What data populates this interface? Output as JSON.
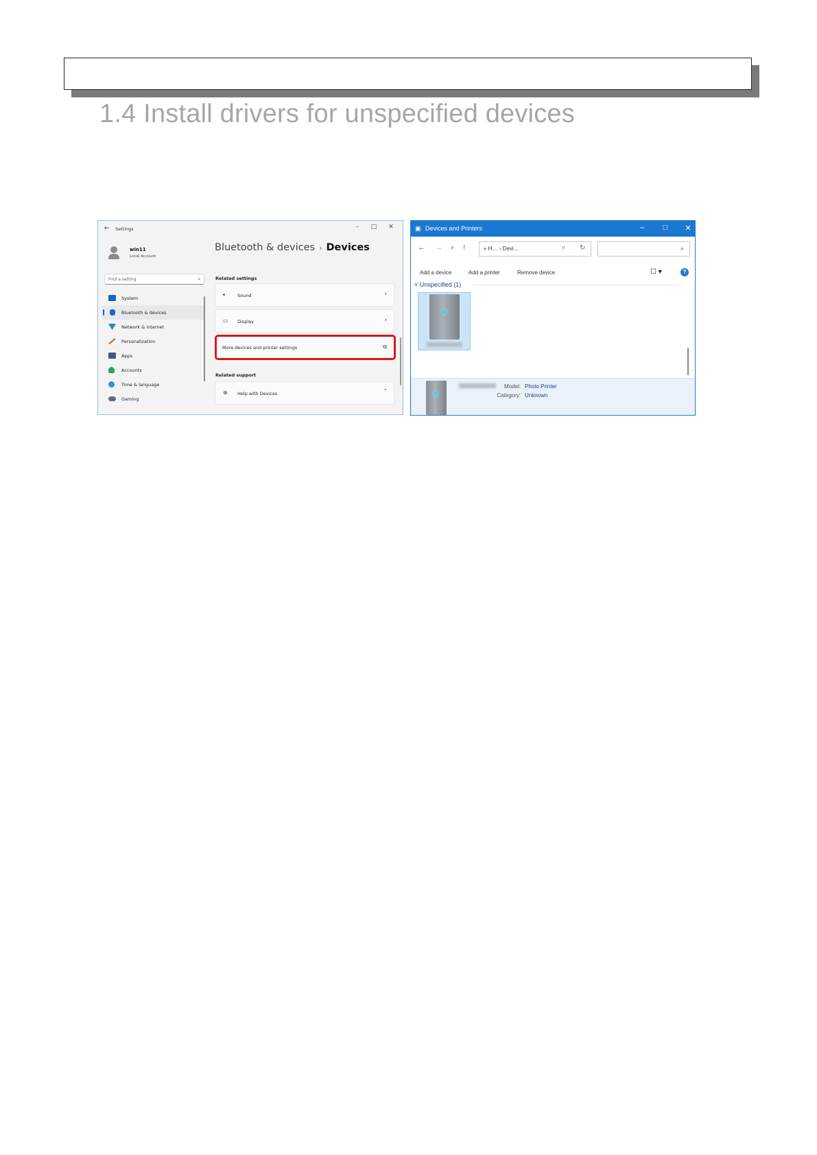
{
  "page": {
    "section_title": "1.4 Install drivers for unspecified devices"
  },
  "settings": {
    "app_title": "Settings",
    "user_name": "win11",
    "account_type": "Local Account",
    "search_placeholder": "Find a setting",
    "nav": [
      {
        "label": "System",
        "color": "#1a66c2"
      },
      {
        "label": "Bluetooth & devices",
        "color": "#1a66c2"
      },
      {
        "label": "Network & internet",
        "color": "#2a7fd4"
      },
      {
        "label": "Personalization",
        "color": "#c77a2a"
      },
      {
        "label": "Apps",
        "color": "#3b5a88"
      },
      {
        "label": "Accounts",
        "color": "#2aa36b"
      },
      {
        "label": "Time & language",
        "color": "#3a8fd0"
      },
      {
        "label": "Gaming",
        "color": "#6a6a6a"
      }
    ],
    "breadcrumb_parent": "Bluetooth & devices",
    "breadcrumb_separator": "›",
    "breadcrumb_current": "Devices",
    "related_settings_heading": "Related settings",
    "sound_label": "Sound",
    "display_label": "Display",
    "more_devices_label": "More devices and printer settings",
    "related_support_heading": "Related support",
    "help_label": "Help with Devices",
    "highlight_color": "#e0151b"
  },
  "dap": {
    "title": "Devices and Printers",
    "address_text": "« H… › Devi…",
    "toolbar": {
      "add_device": "Add a device",
      "add_printer": "Add a printer",
      "remove_device": "Remove device"
    },
    "group_label": "Unspecified (1)",
    "model_label": "Model:",
    "model_value": "Photo Printer",
    "category_label": "Category:",
    "category_value": "Unknown",
    "accent_color": "#1a78d2"
  }
}
